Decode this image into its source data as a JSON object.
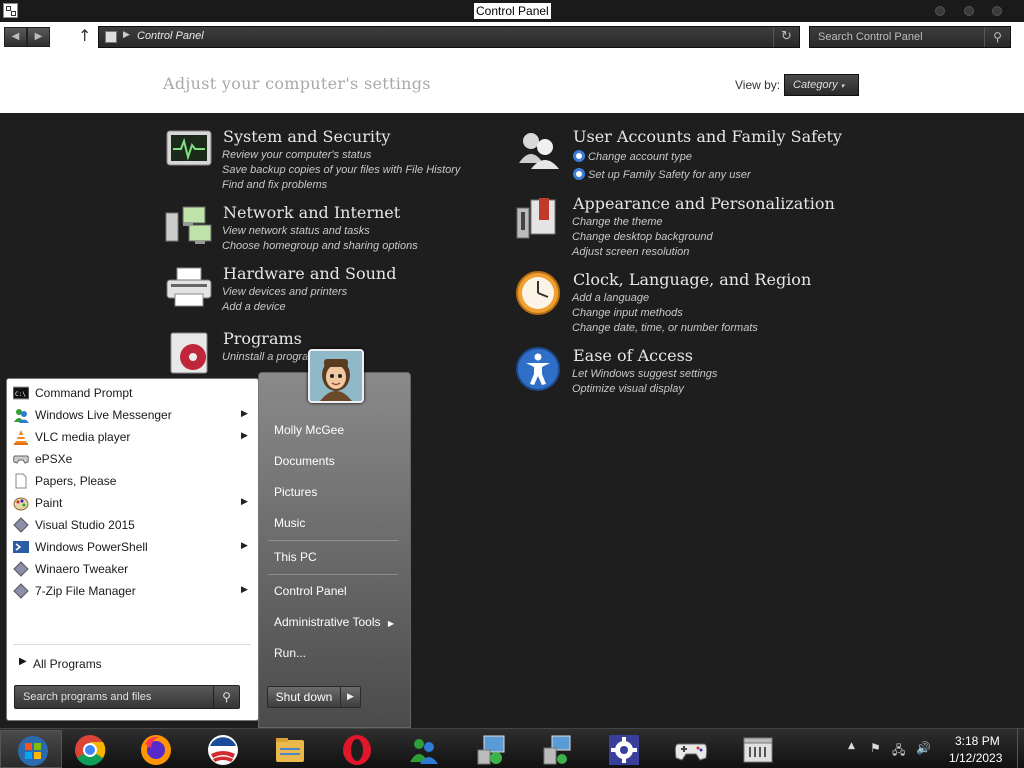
{
  "window": {
    "title": "Control Panel"
  },
  "address_bar": {
    "path": "Control Panel"
  },
  "search": {
    "placeholder": "Search Control Panel"
  },
  "header": {
    "heading": "Adjust your computer's settings",
    "view_by_label": "View by:",
    "view_by_value": "Category"
  },
  "categories": [
    {
      "title": "System and Security",
      "icon": "monitor-heartbeat-icon",
      "links": [
        "Review your computer's status",
        "Save backup copies of your files with File History",
        "Find and fix problems"
      ]
    },
    {
      "title": "Network and Internet",
      "icon": "network-computers-icon",
      "links": [
        "View network status and tasks",
        "Choose homegroup and sharing options"
      ]
    },
    {
      "title": "Hardware and Sound",
      "icon": "printer-icon",
      "links": [
        "View devices and printers",
        "Add a device"
      ]
    },
    {
      "title": "Programs",
      "icon": "programs-disc-icon",
      "links": [
        "Uninstall a program"
      ]
    },
    {
      "title": "User Accounts and Family Safety",
      "icon": "users-icon",
      "links": [
        "Change account type",
        "Set up Family Safety for any user"
      ]
    },
    {
      "title": "Appearance and Personalization",
      "icon": "appearance-icon",
      "links": [
        "Change the theme",
        "Change desktop background",
        "Adjust screen resolution"
      ]
    },
    {
      "title": "Clock, Language, and Region",
      "icon": "clock-icon",
      "links": [
        "Add a language",
        "Change input methods",
        "Change date, time, or number formats"
      ]
    },
    {
      "title": "Ease of Access",
      "icon": "accessibility-icon",
      "links": [
        "Let Windows suggest settings",
        "Optimize visual display"
      ]
    }
  ],
  "start_menu": {
    "programs": [
      {
        "label": "Command Prompt",
        "icon": "cmd-icon",
        "submenu": false
      },
      {
        "label": "Windows Live Messenger",
        "icon": "messenger-icon",
        "submenu": true
      },
      {
        "label": "VLC media player",
        "icon": "vlc-icon",
        "submenu": true
      },
      {
        "label": "ePSXe",
        "icon": "gamepad-icon",
        "submenu": false
      },
      {
        "label": "Papers, Please",
        "icon": "document-icon",
        "submenu": false
      },
      {
        "label": "Paint",
        "icon": "paint-icon",
        "submenu": true
      },
      {
        "label": "Visual Studio 2015",
        "icon": "diamond-icon",
        "submenu": false
      },
      {
        "label": "Windows PowerShell",
        "icon": "powershell-icon",
        "submenu": true
      },
      {
        "label": "Winaero Tweaker",
        "icon": "diamond-icon",
        "submenu": false
      },
      {
        "label": "7-Zip File Manager",
        "icon": "diamond-icon",
        "submenu": true
      }
    ],
    "all_programs": "All Programs",
    "search_placeholder": "Search programs and files",
    "right_items": {
      "user": "Molly McGee",
      "documents": "Documents",
      "pictures": "Pictures",
      "music": "Music",
      "this_pc": "This PC",
      "control_panel": "Control Panel",
      "admin_tools": "Administrative Tools",
      "run": "Run..."
    },
    "shutdown": "Shut down"
  },
  "taskbar": {
    "items": [
      "start-orb-icon",
      "chrome-icon",
      "firefox-icon",
      "obama-logo-icon",
      "file-explorer-icon",
      "opera-icon",
      "messenger-icon",
      "control-panel-icon",
      "network-icon",
      "settings-gear-icon",
      "gamepad-icon",
      "archive-icon"
    ],
    "time": "3:18 PM",
    "date": "1/12/2023"
  }
}
